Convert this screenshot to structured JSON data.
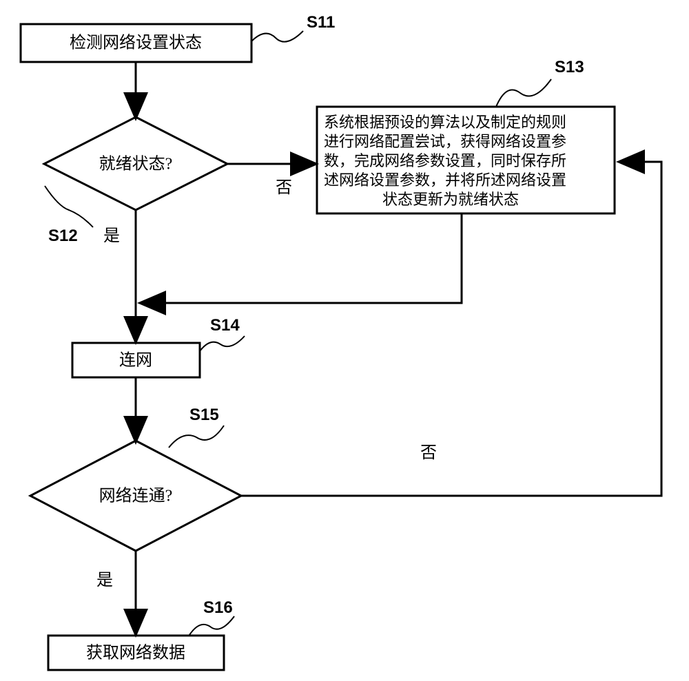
{
  "steps": {
    "s11": {
      "label": "S11",
      "text": "检测网络设置状态"
    },
    "s12": {
      "label": "S12",
      "text": "就绪状态?",
      "yes": "是",
      "no": "否"
    },
    "s13": {
      "label": "S13",
      "line1": "系统根据预设的算法以及制定的规则",
      "line2": "进行网络配置尝试，获得网络设置参",
      "line3": "数，完成网络参数设置，同时保存所",
      "line4": "述网络设置参数，并将所述网络设置",
      "line5": "状态更新为就绪状态"
    },
    "s14": {
      "label": "S14",
      "text": "连网"
    },
    "s15": {
      "label": "S15",
      "text": "网络连通?",
      "yes": "是",
      "no": "否"
    },
    "s16": {
      "label": "S16",
      "text": "获取网络数据"
    }
  }
}
